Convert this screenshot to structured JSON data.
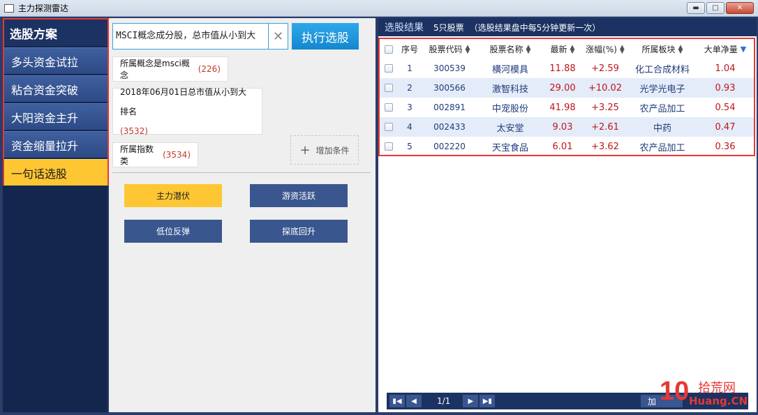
{
  "window": {
    "title": "主力探测雷达"
  },
  "sidebar": {
    "header": "选股方案",
    "items": [
      {
        "label": "多头资金试拉"
      },
      {
        "label": "粘合资金突破"
      },
      {
        "label": "大阳资金主升"
      },
      {
        "label": "资金缩量拉升"
      },
      {
        "label": "一句话选股"
      }
    ]
  },
  "query": {
    "value": "MSCI概念成分股，总市值从小到大",
    "run_label": "执行选股"
  },
  "conditions": [
    {
      "text": "所属概念是msci概念",
      "count": "(226)"
    },
    {
      "text": "2018年06月01日总市值从小到大排名",
      "count": "(3532)"
    },
    {
      "text": "所属指数类",
      "count": "(3534)"
    }
  ],
  "add_condition_label": "增加条件",
  "quick_buttons": [
    {
      "label": "主力潜伏"
    },
    {
      "label": "游资活跃"
    },
    {
      "label": "低位反弹"
    },
    {
      "label": "探底回升"
    }
  ],
  "results": {
    "title": "选股结果",
    "count": "5只股票",
    "note": "（选股结果盘中每5分钟更新一次）",
    "columns": [
      "序号",
      "股票代码",
      "股票名称",
      "最新",
      "涨幅(%)",
      "所属板块",
      "大单净量"
    ],
    "rows": [
      {
        "idx": "1",
        "code": "300539",
        "name": "横河模具",
        "price": "11.88",
        "chg": "+2.59",
        "sector": "化工合成材料",
        "net": "1.04"
      },
      {
        "idx": "2",
        "code": "300566",
        "name": "激智科技",
        "price": "29.00",
        "chg": "+10.02",
        "sector": "光学光电子",
        "net": "0.93"
      },
      {
        "idx": "3",
        "code": "002891",
        "name": "中宠股份",
        "price": "41.98",
        "chg": "+3.25",
        "sector": "农产品加工",
        "net": "0.54"
      },
      {
        "idx": "4",
        "code": "002433",
        "name": "太安堂",
        "price": "9.03",
        "chg": "+2.61",
        "sector": "中药",
        "net": "0.47"
      },
      {
        "idx": "5",
        "code": "002220",
        "name": "天宝食品",
        "price": "6.01",
        "chg": "+3.62",
        "sector": "农产品加工",
        "net": "0.36"
      }
    ]
  },
  "pager": {
    "info": "1/1",
    "join_label": "加"
  },
  "watermark": {
    "number": "10",
    "site": "拾荒网",
    "domain": "Huang.CN"
  }
}
